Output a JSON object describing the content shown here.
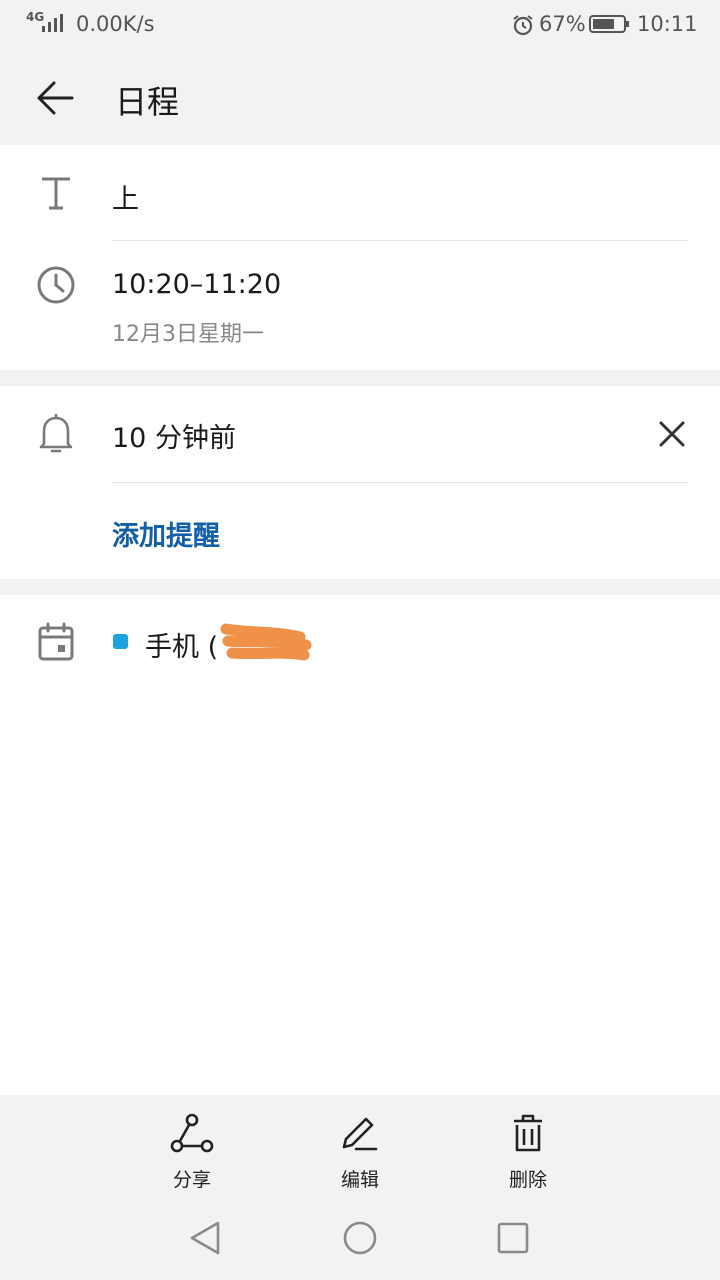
{
  "status_bar": {
    "network": "4G",
    "speed": "0.00K/s",
    "battery": "67%",
    "time": "10:11"
  },
  "app_bar": {
    "title": "日程"
  },
  "event": {
    "title": "上",
    "time_range": "10:20–11:20",
    "date": "12月3日星期一"
  },
  "reminder": {
    "value": "10 分钟前",
    "add_label": "添加提醒"
  },
  "calendar": {
    "account_label": "手机 (",
    "account_color": "#1aa3e0"
  },
  "actions": {
    "share": "分享",
    "edit": "编辑",
    "delete": "删除"
  },
  "colors": {
    "accent": "#135fa8",
    "redaction": "#f0914a"
  }
}
